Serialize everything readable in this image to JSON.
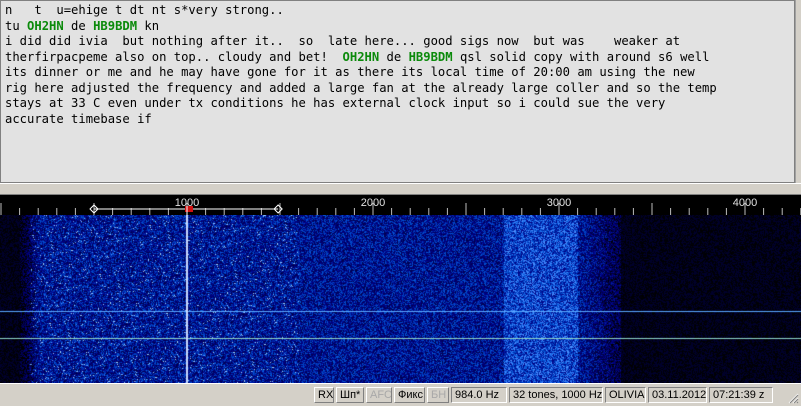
{
  "rx_text": {
    "lines": [
      [
        {
          "t": "n   t  u=ehige t dt nt s*very strong.."
        }
      ],
      [
        {
          "t": "tu "
        },
        {
          "t": "OH2HN",
          "call": true
        },
        {
          "t": " de "
        },
        {
          "t": "HB9BDM",
          "call": true
        },
        {
          "t": " kn"
        }
      ],
      [
        {
          "t": "i did did ivia  but nothing after it..  so  late here... good sigs now  but was    weaker at"
        }
      ],
      [
        {
          "t": "therfirpacpeme also on top.. cloudy and bet!  "
        },
        {
          "t": "OH2HN",
          "call": true
        },
        {
          "t": " de "
        },
        {
          "t": "HB9BDM",
          "call": true
        },
        {
          "t": " qsl solid copy with around s6 well"
        }
      ],
      [
        {
          "t": "its dinner or me and he may have gone for it as there its local time of 20:00 am using the new"
        }
      ],
      [
        {
          "t": "rig here adjusted the frequency and added a large fan at the already large coller and so the temp"
        }
      ],
      [
        {
          "t": "stays at 33 C even under tx conditions he has external clock input so i could sue the very"
        }
      ],
      [
        {
          "t": "accurate timebase if"
        }
      ]
    ]
  },
  "scale": {
    "hz_min": 0,
    "hz_max": 4300,
    "labels": [
      "1000",
      "2000",
      "3000",
      "4000"
    ],
    "label_values": [
      1000,
      2000,
      3000,
      4000
    ],
    "cursor_hz": 1000,
    "bandwidth_left_hz": 500,
    "bandwidth_right_hz": 1490
  },
  "waterfall": {
    "signal_start_hz": 100,
    "signal_end_hz": 3330,
    "peak_start_hz": 2700,
    "peak_end_hz": 3100,
    "cursor_hz": 1000,
    "spur_levels": [
      0.57,
      0.73
    ]
  },
  "status": {
    "rx": "RX",
    "squelch": "Шп*",
    "afc": "AFC",
    "fix": "Фикс",
    "bh": "БН",
    "freq": "984.0 Hz",
    "tones": "32 tones, 1000 Hz",
    "mode": "OLIVIA",
    "date": "03.11.2012",
    "time": "07:21:39 z"
  },
  "colors": {
    "callsign": "#0b8a0b",
    "scale_text": "#e0e0e0",
    "cursor_flag": "#d01010",
    "cursor_line": "#c8d8ff"
  }
}
